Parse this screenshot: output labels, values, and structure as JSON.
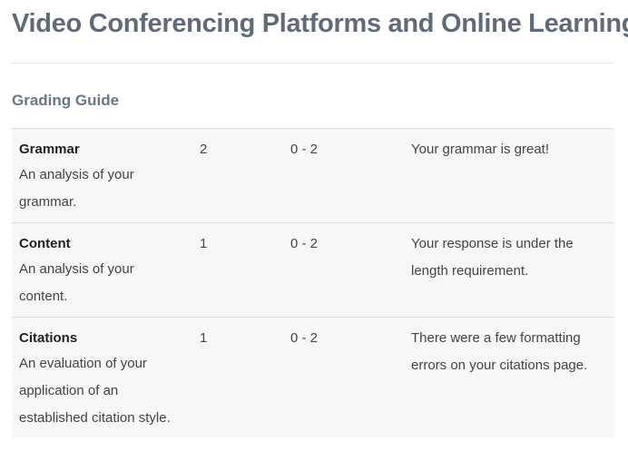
{
  "page": {
    "title": "Video Conferencing Platforms and Online Learning"
  },
  "grading_guide": {
    "heading": "Grading Guide",
    "rows": [
      {
        "criterion": "Grammar",
        "description": "An analysis of your grammar.",
        "score": "2",
        "range": "0 - 2",
        "feedback": "Your grammar is great!"
      },
      {
        "criterion": "Content",
        "description": "An analysis of your content.",
        "score": "1",
        "range": "0 - 2",
        "feedback": "Your response is under the length requirement."
      },
      {
        "criterion": "Citations",
        "description": "An evaluation of your application of an established citation style.",
        "score": "1",
        "range": "0 - 2",
        "feedback": "There were a few formatting errors on your citations page."
      }
    ]
  },
  "colors": {
    "title": "#5f6b7a",
    "section_heading": "#6b7785",
    "table_background": "#f7f7f7",
    "divider": "#dddddd"
  }
}
